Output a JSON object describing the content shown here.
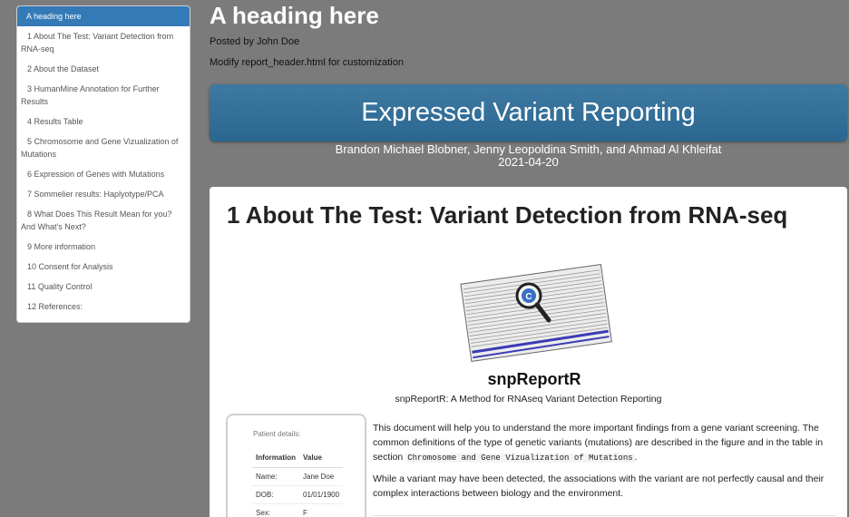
{
  "toc": {
    "items": [
      {
        "label": "A heading here",
        "active": true
      },
      {
        "label": "1 About The Test: Variant Detection from RNA-seq"
      },
      {
        "label": "2 About the Dataset"
      },
      {
        "label": "3 HumanMine Annotation for Further Results"
      },
      {
        "label": "4 Results Table"
      },
      {
        "label": "5 Chromosome and Gene Vizualization of Mutations"
      },
      {
        "label": "6 Expression of Genes with Mutations"
      },
      {
        "label": "7 Sommelier results: Haplyotype/PCA"
      },
      {
        "label": "8 What Does This Result Mean for you? And What's Next?"
      },
      {
        "label": "9 More information"
      },
      {
        "label": "10 Consent for Analysis"
      },
      {
        "label": "11 Quality Control"
      },
      {
        "label": "12 References:"
      }
    ]
  },
  "header": {
    "heading": "A heading here",
    "posted_by": "Posted by John Doe",
    "modify_note": "Modify report_header.html for customization"
  },
  "banner": {
    "title": "Expressed Variant Reporting",
    "authors": "Brandon Michael Blobner, Jenny Leopoldina Smith, and Ahmad Al Khleifat",
    "date": "2021-04-20"
  },
  "section": {
    "title": "1 About The Test: Variant Detection from RNA-seq",
    "logo_text": "snpReportR",
    "logo_badge": "C",
    "figure_caption": "snpReportR: A Method for RNAseq Variant Detection Reporting",
    "paragraph1_pre": "This document will help you to understand the more important findings from a gene variant screening. The common definitions of the type of genetic variants (mutations) are described in the figure and in the table in section ",
    "paragraph1_code": "Chromosome and Gene Vizualization of Mutations",
    "paragraph1_post": ".",
    "paragraph2": "While a variant may have been detected, the associations with the variant are not perfectly causal and their complex interactions between biology and the environment."
  },
  "patient": {
    "title": "Patient details:",
    "headers": [
      "Information",
      "Value"
    ],
    "rows": [
      [
        "Name:",
        "Jane Doe"
      ],
      [
        "DOB:",
        "01/01/1900"
      ],
      [
        "Sex:",
        "F"
      ]
    ]
  },
  "colors": {
    "background": "#7b7b7b",
    "banner": "#2f6d97",
    "toc_active": "#337ab7"
  }
}
